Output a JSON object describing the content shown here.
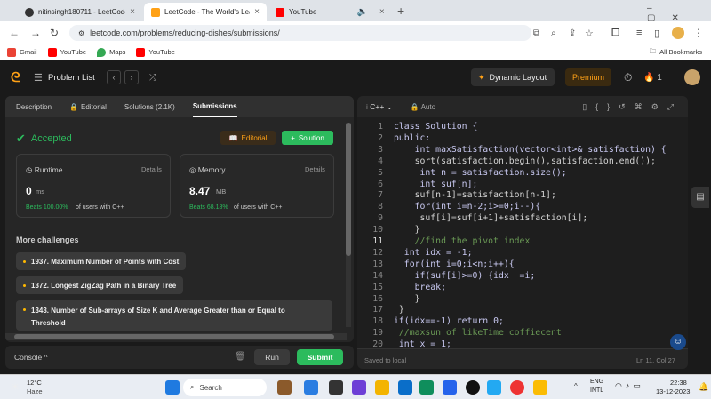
{
  "browser": {
    "tabs": [
      {
        "title": "nitinsingh180711 - LeetCode P"
      },
      {
        "title": "LeetCode - The World's Leadin"
      },
      {
        "title": "YouTube"
      }
    ],
    "new_tab": "+",
    "url": "leetcode.com/problems/reducing-dishes/submissions/",
    "bookmarks": [
      "Gmail",
      "YouTube",
      "Maps",
      "YouTube"
    ],
    "all_bookmarks": "All Bookmarks"
  },
  "header": {
    "problem_list": "Problem List",
    "dynamic_layout": "Dynamic Layout",
    "premium": "Premium",
    "streak": "1"
  },
  "left": {
    "tabs": [
      "Description",
      "Editorial",
      "Solutions (2.1K)",
      "Submissions"
    ],
    "status": "Accepted",
    "editorial_btn": "Editorial",
    "solution_btn": "Solution",
    "runtime": {
      "label": "Runtime",
      "details": "Details",
      "value": "0",
      "unit": "ms",
      "beats": "Beats 100.00%",
      "suffix": "of users with C++"
    },
    "memory": {
      "label": "Memory",
      "details": "Details",
      "value": "8.47",
      "unit": "MB",
      "beats": "Beats 68.18%",
      "suffix": "of users with C++"
    },
    "more": "More challenges",
    "challenges": [
      "1937. Maximum Number of Points with Cost",
      "1372. Longest ZigZag Path in a Binary Tree",
      "1343. Number of Sub-arrays of Size K and Average Greater than or Equal to",
      "Threshold"
    ],
    "console": "Console",
    "run": "Run",
    "submit": "Submit"
  },
  "editor": {
    "lang": "C++",
    "mode": "Auto",
    "saved": "Saved to local",
    "cursor": "Ln 11, Col 27",
    "lines": [
      {
        "n": "1",
        "t": "class Solution {"
      },
      {
        "n": "2",
        "t": "public:"
      },
      {
        "n": "3",
        "t": "    int maxSatisfaction(vector<int>& satisfaction) {"
      },
      {
        "n": "4",
        "t": "    sort(satisfaction.begin(),satisfaction.end());"
      },
      {
        "n": "5",
        "t": "     int n = satisfaction.size();"
      },
      {
        "n": "6",
        "t": "     int suf[n];"
      },
      {
        "n": "7",
        "t": "    suf[n-1]=satisfaction[n-1];"
      },
      {
        "n": "8",
        "t": "    for(int i=n-2;i>=0;i--){"
      },
      {
        "n": "9",
        "t": "     suf[i]=suf[i+1]+satisfaction[i];"
      },
      {
        "n": "10",
        "t": "    }"
      },
      {
        "n": "11",
        "t": "    //find the pivot index"
      },
      {
        "n": "12",
        "t": "  int idx = -1;"
      },
      {
        "n": "13",
        "t": "  for(int i=0;i<n;i++){"
      },
      {
        "n": "14",
        "t": "    if(suf[i]>=0) {idx  =i;"
      },
      {
        "n": "15",
        "t": "    break;"
      },
      {
        "n": "16",
        "t": "    }"
      },
      {
        "n": "17",
        "t": " }"
      },
      {
        "n": "18",
        "t": "if(idx==-1) return 0;"
      },
      {
        "n": "19",
        "t": " //maxsun of likeTime coffiecent"
      },
      {
        "n": "20",
        "t": " int x = 1;"
      }
    ]
  },
  "taskbar": {
    "temp": "12°C",
    "weather": "Haze",
    "search": "Search",
    "lang1": "ENG",
    "lang2": "INTL",
    "time": "22:38",
    "date": "13-12-2023"
  },
  "colors": {
    "accent": "#2cbb5d",
    "premium": "#ffa116",
    "bg": "#1a1a1a"
  }
}
